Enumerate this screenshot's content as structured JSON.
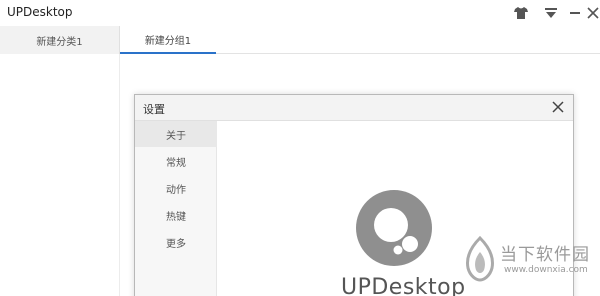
{
  "window": {
    "title": "UPDesktop",
    "controls": {
      "skin": "shirt-icon",
      "menu": "menu-dropdown-icon",
      "minimize": "minimize-icon",
      "close": "close-icon"
    }
  },
  "categories": {
    "active": "新建分类1"
  },
  "groups": {
    "active": "新建分组1"
  },
  "settings_dialog": {
    "title": "设置",
    "nav": [
      {
        "label": "关于",
        "active": true
      },
      {
        "label": "常规",
        "active": false
      },
      {
        "label": "动作",
        "active": false
      },
      {
        "label": "热键",
        "active": false
      },
      {
        "label": "更多",
        "active": false
      }
    ],
    "about": {
      "app_name": "UPDesktop"
    }
  },
  "watermark": {
    "title": "当下软件园",
    "url": "www.downxia.com"
  },
  "colors": {
    "accent": "#2a72c9",
    "logo_gray": "#8f8f8f",
    "watermark": "#9a9a9a"
  }
}
